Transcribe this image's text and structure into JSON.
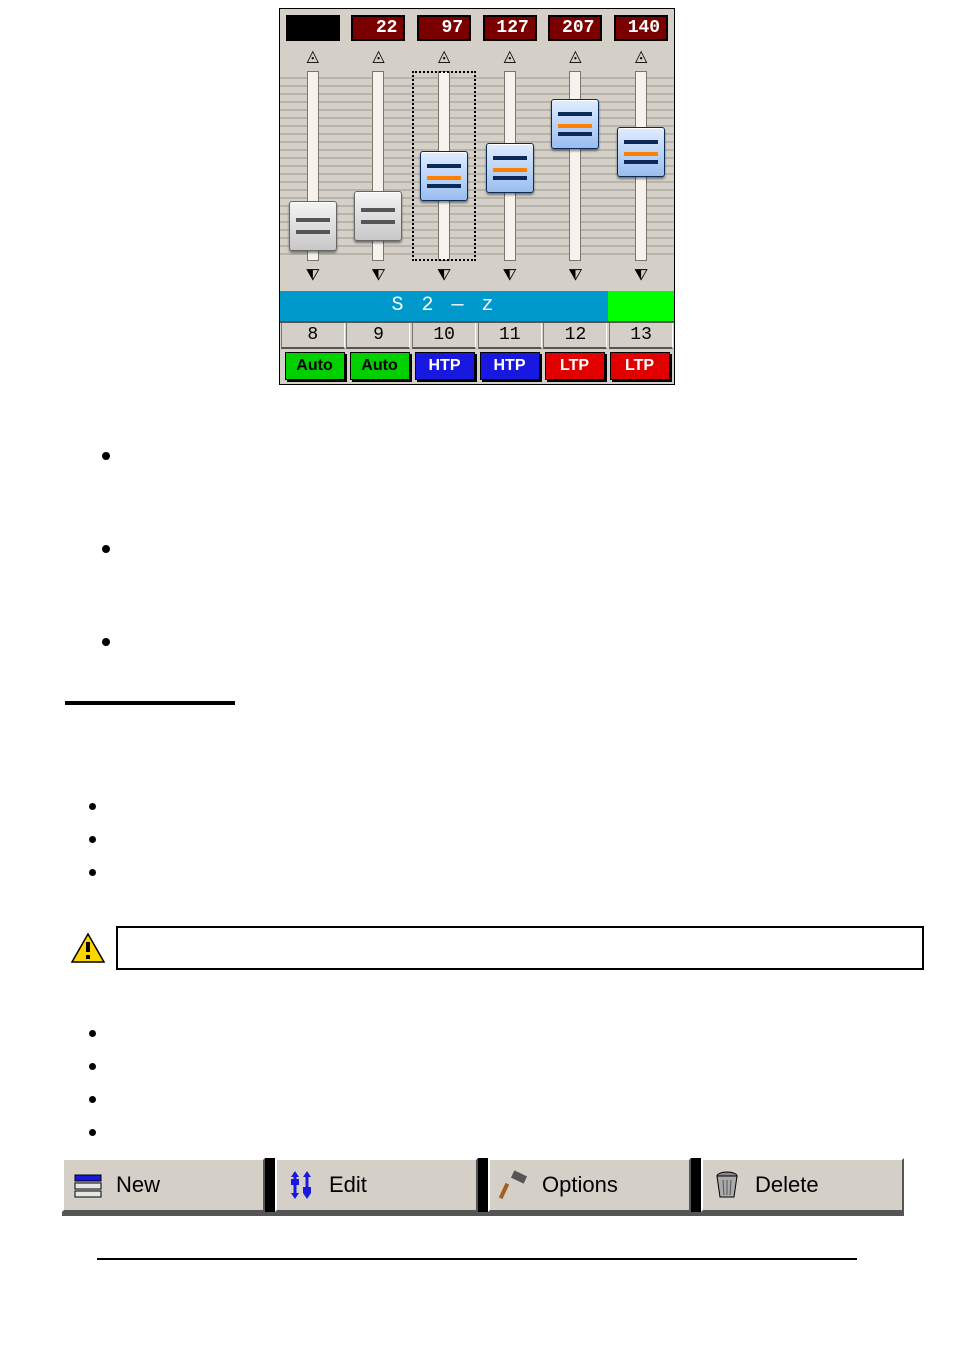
{
  "faders": {
    "columns": [
      {
        "value": "",
        "num": "8",
        "mode": "Auto",
        "knobTop": 130,
        "knobClass": "gray",
        "selected": false
      },
      {
        "value": "22",
        "num": "9",
        "mode": "Auto",
        "knobTop": 120,
        "knobClass": "gray",
        "selected": false
      },
      {
        "value": "97",
        "num": "10",
        "mode": "HTP",
        "knobTop": 80,
        "knobClass": "",
        "selected": true
      },
      {
        "value": "127",
        "num": "11",
        "mode": "HTP",
        "knobTop": 72,
        "knobClass": "",
        "selected": false
      },
      {
        "value": "207",
        "num": "12",
        "mode": "LTP",
        "knobTop": 28,
        "knobClass": "",
        "selected": false
      },
      {
        "value": "140",
        "num": "13",
        "mode": "LTP",
        "knobTop": 56,
        "knobClass": "",
        "selected": false
      }
    ],
    "label": "S 2 — z"
  },
  "toolbar": {
    "new": "New",
    "edit": "Edit",
    "options": "Options",
    "delete": "Delete"
  }
}
